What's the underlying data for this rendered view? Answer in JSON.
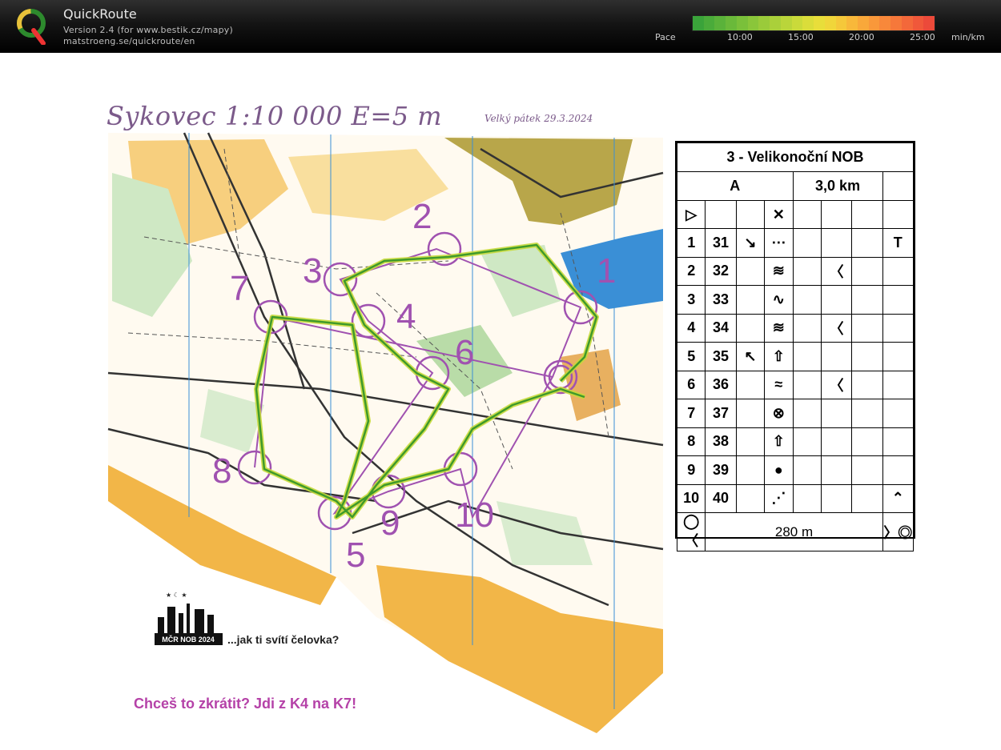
{
  "app": {
    "title": "QuickRoute",
    "version_line": "Version 2.4  (for www.bestik.cz/mapy)",
    "url_line": "matstroeng.se/quickroute/en"
  },
  "pace": {
    "label": "Pace",
    "ticks": [
      "10:00",
      "15:00",
      "20:00",
      "25:00"
    ],
    "unit": "min/km",
    "colors": [
      "#3aa33a",
      "#4aab3a",
      "#5ab23a",
      "#6ab93a",
      "#7ac03a",
      "#8ac63a",
      "#9acb3a",
      "#aad03a",
      "#bad53a",
      "#cada3a",
      "#dadd3a",
      "#e8de3a",
      "#f0d63a",
      "#f5c83a",
      "#f8b83a",
      "#f9a83a",
      "#f9983a",
      "#f8883a",
      "#f6783a",
      "#f3683a",
      "#f0583a",
      "#ec4a3a"
    ]
  },
  "map": {
    "title": "Sykovec  1:10 000  E=5 m",
    "date": "Velký pátek 29.3.2024",
    "colors": {
      "course": "#a052b0",
      "route": "#3f9a2a",
      "open": "#f6c76a",
      "forest": "#cfe8c4",
      "water": "#3a8fd6",
      "urban": "#b8a64a"
    },
    "controls": [
      "1",
      "2",
      "3",
      "4",
      "5",
      "6",
      "7",
      "8",
      "9",
      "10"
    ]
  },
  "description": {
    "title": "3 - Velikonoční NOB",
    "class_name": "A",
    "length": "3,0 km",
    "rows": [
      {
        "n": "1",
        "code": "31",
        "dir": "↘",
        "feature": "⋯",
        "extra": "",
        "side": "T"
      },
      {
        "n": "2",
        "code": "32",
        "dir": "",
        "feature": "≋",
        "extra": "〈",
        "side": ""
      },
      {
        "n": "3",
        "code": "33",
        "dir": "",
        "feature": "∿",
        "extra": "",
        "side": ""
      },
      {
        "n": "4",
        "code": "34",
        "dir": "",
        "feature": "≋",
        "extra": "〈",
        "side": ""
      },
      {
        "n": "5",
        "code": "35",
        "dir": "↖",
        "feature": "⇧",
        "extra": "",
        "side": ""
      },
      {
        "n": "6",
        "code": "36",
        "dir": "",
        "feature": "≈",
        "extra": "〈",
        "side": ""
      },
      {
        "n": "7",
        "code": "37",
        "dir": "",
        "feature": "⊗",
        "extra": "",
        "side": ""
      },
      {
        "n": "8",
        "code": "38",
        "dir": "",
        "feature": "⇧",
        "extra": "",
        "side": ""
      },
      {
        "n": "9",
        "code": "39",
        "dir": "",
        "feature": "●",
        "extra": "",
        "side": ""
      },
      {
        "n": "10",
        "code": "40",
        "dir": "",
        "feature": "⋰",
        "extra": "",
        "side": "⌃"
      }
    ],
    "finish_distance": "280 m"
  },
  "event_logo": {
    "label": "MČR NOB 2024"
  },
  "slogan": "...jak ti svítí čelovka?",
  "hint": "Chceš to zkrátit? Jdi z K4 na K7!"
}
